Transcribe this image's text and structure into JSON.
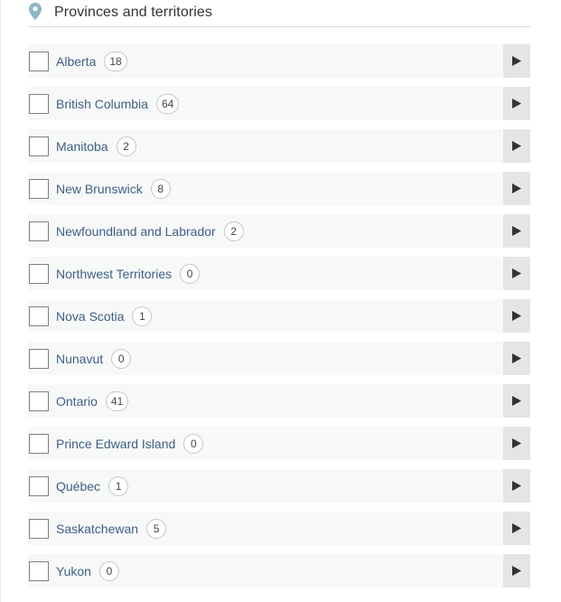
{
  "filter": {
    "title": "Provinces and territories",
    "icon": "map-pin-icon",
    "icon_color": "#8fb6c6",
    "label_color": "#3f5f86",
    "items": [
      {
        "label": "Alberta",
        "count": "18"
      },
      {
        "label": "British Columbia",
        "count": "64"
      },
      {
        "label": "Manitoba",
        "count": "2"
      },
      {
        "label": "New Brunswick",
        "count": "8"
      },
      {
        "label": "Newfoundland and Labrador",
        "count": "2"
      },
      {
        "label": "Northwest Territories",
        "count": "0"
      },
      {
        "label": "Nova Scotia",
        "count": "1"
      },
      {
        "label": "Nunavut",
        "count": "0"
      },
      {
        "label": "Ontario",
        "count": "41"
      },
      {
        "label": "Prince Edward Island",
        "count": "0"
      },
      {
        "label": "Québec",
        "count": "1"
      },
      {
        "label": "Saskatchewan",
        "count": "5"
      },
      {
        "label": "Yukon",
        "count": "0"
      }
    ],
    "expand_icon": "play-triangle-icon",
    "checked": [
      false,
      false,
      false,
      false,
      false,
      false,
      false,
      false,
      false,
      false,
      false,
      false,
      false
    ]
  }
}
